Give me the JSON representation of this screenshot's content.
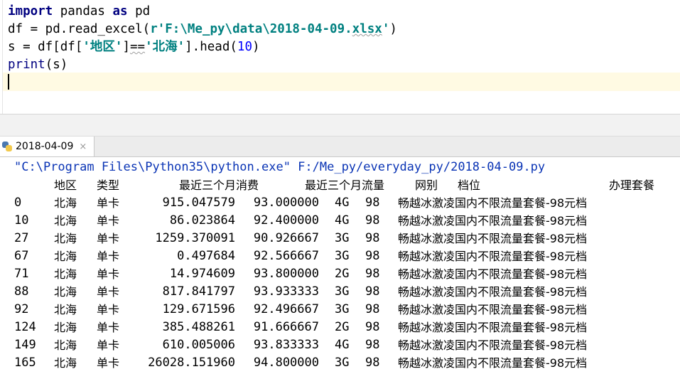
{
  "editor": {
    "line1": {
      "kw_import": "import",
      "mod": " pandas ",
      "kw_as": "as",
      "alias": " pd"
    },
    "line2": {
      "pre": "df = pd.read_excel(",
      "str": "r'F:\\Me_py\\data\\2018-04-09.",
      "str_ext": "xlsx",
      "str_end": "'",
      "post": ")"
    },
    "line3": {
      "pre": "s = df[df[",
      "key": "'地区'",
      "eq": "]",
      "op": "==",
      "val": "'北海'",
      "mid": "].head(",
      "num": "10",
      "post": ")"
    },
    "line4": {
      "fn": "print",
      "args": "(s)"
    }
  },
  "run_tab": {
    "label": "2018-04-09",
    "close": "×"
  },
  "console": {
    "command": "\"C:\\Program Files\\Python35\\python.exe\" F:/Me_py/everyday_py/2018-04-09.py",
    "headers": {
      "region": "地区",
      "type": "类型",
      "fee": "最近三个月消费",
      "flow": "最近三个月流量",
      "net": "网别",
      "tier": "档位",
      "plan": "办理套餐"
    },
    "rows": [
      {
        "idx": "0",
        "region": "北海",
        "type": "单卡",
        "fee": "915.047579",
        "flow": "93.000000",
        "net": "4G",
        "tier": "98",
        "plan": "畅越冰激凌国内不限流量套餐-98元档"
      },
      {
        "idx": "10",
        "region": "北海",
        "type": "单卡",
        "fee": "86.023864",
        "flow": "92.400000",
        "net": "4G",
        "tier": "98",
        "plan": "畅越冰激凌国内不限流量套餐-98元档"
      },
      {
        "idx": "27",
        "region": "北海",
        "type": "单卡",
        "fee": "1259.370091",
        "flow": "90.926667",
        "net": "3G",
        "tier": "98",
        "plan": "畅越冰激凌国内不限流量套餐-98元档"
      },
      {
        "idx": "67",
        "region": "北海",
        "type": "单卡",
        "fee": "0.497684",
        "flow": "92.566667",
        "net": "3G",
        "tier": "98",
        "plan": "畅越冰激凌国内不限流量套餐-98元档"
      },
      {
        "idx": "71",
        "region": "北海",
        "type": "单卡",
        "fee": "14.974609",
        "flow": "93.800000",
        "net": "2G",
        "tier": "98",
        "plan": "畅越冰激凌国内不限流量套餐-98元档"
      },
      {
        "idx": "88",
        "region": "北海",
        "type": "单卡",
        "fee": "817.841797",
        "flow": "93.933333",
        "net": "3G",
        "tier": "98",
        "plan": "畅越冰激凌国内不限流量套餐-98元档"
      },
      {
        "idx": "92",
        "region": "北海",
        "type": "单卡",
        "fee": "129.671596",
        "flow": "92.496667",
        "net": "3G",
        "tier": "98",
        "plan": "畅越冰激凌国内不限流量套餐-98元档"
      },
      {
        "idx": "124",
        "region": "北海",
        "type": "单卡",
        "fee": "385.488261",
        "flow": "91.666667",
        "net": "2G",
        "tier": "98",
        "plan": "畅越冰激凌国内不限流量套餐-98元档"
      },
      {
        "idx": "149",
        "region": "北海",
        "type": "单卡",
        "fee": "610.005006",
        "flow": "93.833333",
        "net": "4G",
        "tier": "98",
        "plan": "畅越冰激凌国内不限流量套餐-98元档"
      },
      {
        "idx": "165",
        "region": "北海",
        "type": "单卡",
        "fee": "26028.151960",
        "flow": "94.800000",
        "net": "3G",
        "tier": "98",
        "plan": "畅越冰激凌国内不限流量套餐-98元档"
      }
    ]
  },
  "colors": {
    "keyword": "#000080",
    "string": "#008080",
    "number": "#0000ff",
    "command": "#0a34b5",
    "current_line": "#fffae3"
  }
}
